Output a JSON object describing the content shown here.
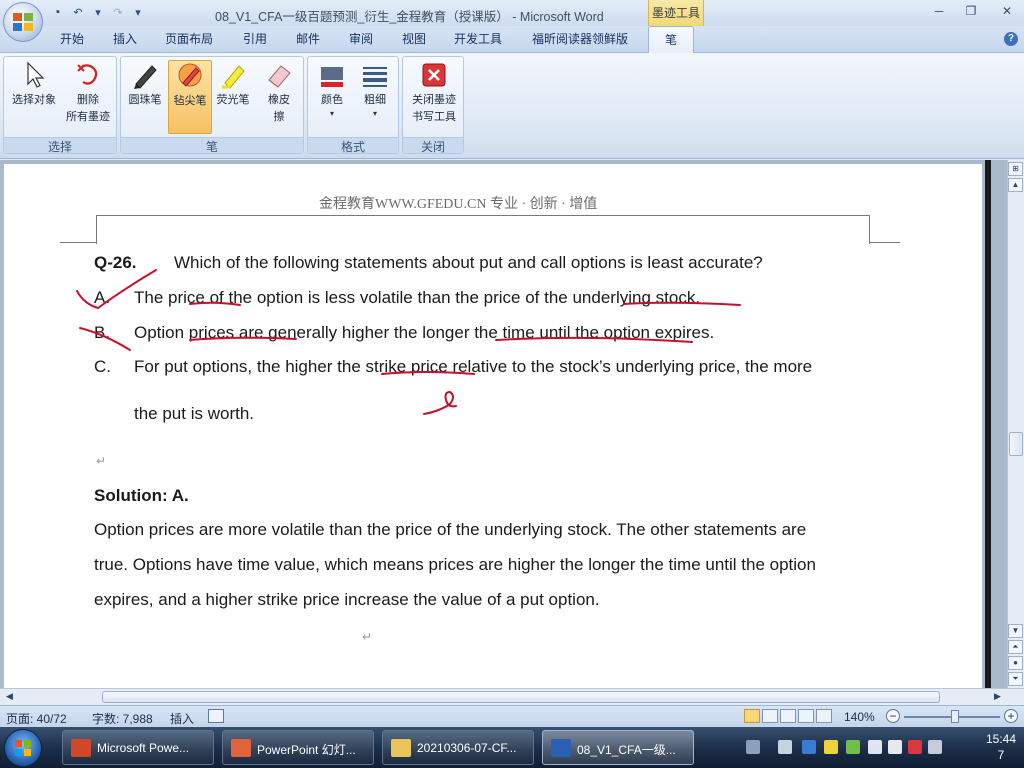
{
  "window": {
    "title": "08_V1_CFA一级百题预测_衍生_金程教育（授课版） - Microsoft Word",
    "context_tab_group": "墨迹工具"
  },
  "tabs": [
    "开始",
    "插入",
    "页面布局",
    "引用",
    "邮件",
    "审阅",
    "视图",
    "开发工具",
    "福昕阅读器领鲜版",
    "笔"
  ],
  "ribbon": {
    "groups": {
      "select": {
        "label": "选择",
        "buttons": {
          "select_objects": "选择对象",
          "delete_line1": "删除",
          "delete_line2": "所有墨迹"
        }
      },
      "pen": {
        "label": "笔",
        "buttons": {
          "ballpoint": "圆珠笔",
          "felt_tip": "毡尖笔",
          "highlighter": "荧光笔",
          "eraser_line1": "橡皮",
          "eraser_line2": "擦"
        }
      },
      "format": {
        "label": "格式",
        "buttons": {
          "color": "颜色",
          "thickness": "粗细"
        }
      },
      "close": {
        "label": "关闭",
        "buttons": {
          "close_line1": "关闭墨迹",
          "close_line2": "书写工具"
        }
      }
    }
  },
  "document": {
    "header": "金程教育WWW.GFEDU.CN 专业 · 创新 · 增值",
    "question": {
      "number": "Q-26.",
      "text": "Which of the following statements about put and call options is least accurate?"
    },
    "options": [
      {
        "letter": "A.",
        "text": "The price of the option is less volatile than the price of the underlying stock."
      },
      {
        "letter": "B.",
        "text": "Option prices are generally higher the longer the time until the option expires."
      },
      {
        "letter": "C.",
        "text": "For put options, the higher the strike price relative to the stock’s underlying price, the more"
      }
    ],
    "option_c_line2": "the put is worth.",
    "solution_heading": "Solution: A.",
    "solution_lines": [
      "Option prices are more volatile than the price of the underlying stock. The other statements are",
      "true. Options have time value, which means prices are higher the longer the time until the option",
      "expires, and a higher strike price increase the value of a put option."
    ],
    "para_mark": "↵"
  },
  "statusbar": {
    "page": "页面: 40/72",
    "words": "字数: 7,988",
    "insert": "插入",
    "zoom": "140%"
  },
  "taskbar": {
    "items": [
      "Microsoft Powe...",
      "PowerPoint 幻灯...",
      "20210306-07-CF...",
      "08_V1_CFA一级..."
    ],
    "time": "15:44",
    "date_line": "7"
  },
  "colors": {
    "ink": "#c8102e",
    "ribbon_bg": "#dde8f5",
    "taskbar": "#1b2d47"
  }
}
